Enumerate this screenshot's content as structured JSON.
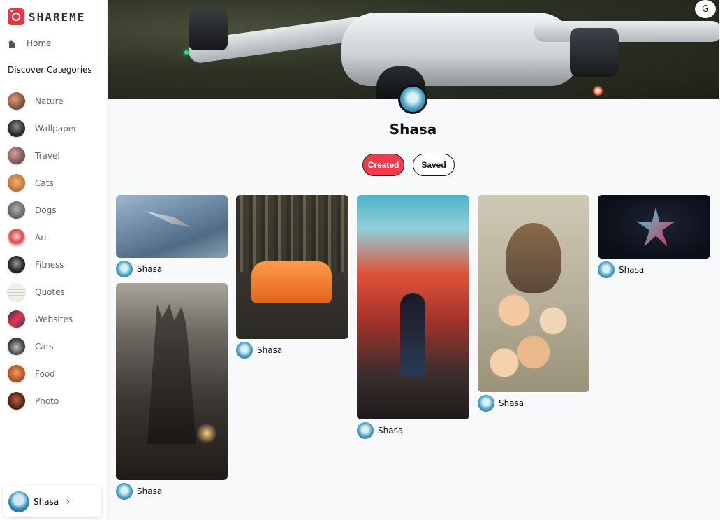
{
  "app": {
    "name": "SHAREME"
  },
  "sidebar": {
    "home_label": "Home",
    "categories_heading": "Discover Categories",
    "categories": [
      {
        "label": "Nature",
        "color": "#6b4a3a"
      },
      {
        "label": "Wallpaper",
        "color": "#2a2a2a"
      },
      {
        "label": "Travel",
        "color": "#7a5a5a"
      },
      {
        "label": "Cats",
        "color": "#c77a3a"
      },
      {
        "label": "Dogs",
        "color": "#6a6a6a"
      },
      {
        "label": "Art",
        "color": "#d64a4a"
      },
      {
        "label": "Fitness",
        "color": "#2a2a2a"
      },
      {
        "label": "Quotes",
        "color": "#e8e4dc"
      },
      {
        "label": "Websites",
        "color": "#2a3a6a"
      },
      {
        "label": "Cars",
        "color": "#4a4a4a"
      },
      {
        "label": "Food",
        "color": "#b85a2a"
      },
      {
        "label": "Photo",
        "color": "#5a2a1a"
      }
    ],
    "user_name": "Shasa"
  },
  "profile": {
    "name": "Shasa",
    "tabs": {
      "created": "Created",
      "saved": "Saved"
    },
    "active_tab": "Created"
  },
  "pins": [
    {
      "author": "Shasa",
      "image": "fighter-jet"
    },
    {
      "author": "Shasa",
      "image": "gothic-castle"
    },
    {
      "author": "Shasa",
      "image": "orange-sports-car"
    },
    {
      "author": "Shasa",
      "image": "anime-girl-explosion"
    },
    {
      "author": "Shasa",
      "image": "floral-bird"
    },
    {
      "author": "Shasa",
      "image": "neon-star"
    }
  ],
  "colors": {
    "accent": "#f23a4b",
    "background": "#f8f9fb"
  }
}
